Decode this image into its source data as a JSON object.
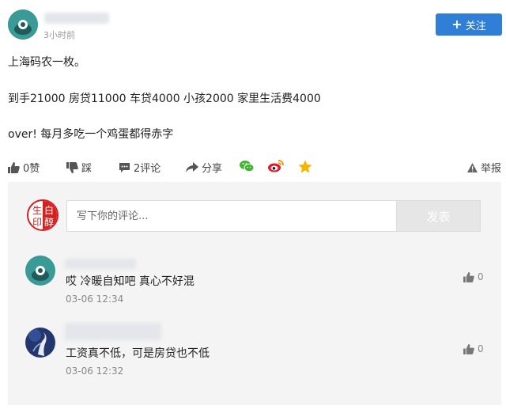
{
  "post": {
    "time": "3小时前",
    "follow_label": "关注",
    "lines": [
      "上海码农一枚。",
      "到手21000 房贷11000 车贷4000 小孩2000 家里生活费4000",
      "over! 每月多吃一个鸡蛋都得赤字"
    ]
  },
  "actions": {
    "like": "0赞",
    "dislike": "踩",
    "comments": "2评论",
    "share": "分享",
    "report": "举报"
  },
  "comment_box": {
    "placeholder": "写下你的评论...",
    "submit_label": "发表",
    "seal_text": [
      "白",
      "生",
      "印",
      "醇"
    ]
  },
  "comments": [
    {
      "text": "哎 冷暖自知吧 真心不好混",
      "time": "03-06 12:34",
      "likes": "0"
    },
    {
      "text": "工资真不低，可是房贷也不低",
      "time": "03-06 12:32",
      "likes": "0"
    }
  ],
  "colors": {
    "follow": "#2f7fd6",
    "avatar_teal": "#3a9a96",
    "seal_red": "#d32020",
    "wechat": "#3fb62f",
    "weibo": "#e6162d",
    "star": "#f5b400"
  }
}
